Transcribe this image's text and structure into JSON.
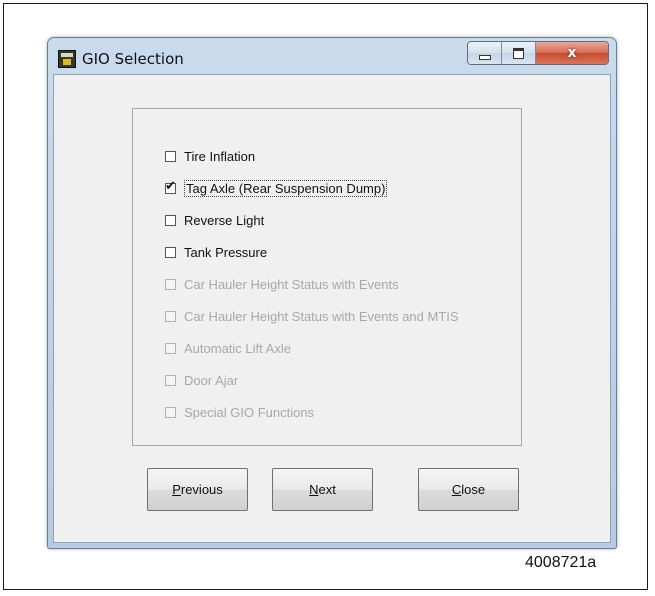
{
  "window": {
    "title": "GIO Selection",
    "close_glyph": "x",
    "icon": "app-icon"
  },
  "options": [
    {
      "label": "Tire Inflation",
      "checked": false,
      "enabled": true
    },
    {
      "label": "Tag Axle (Rear Suspension Dump)",
      "checked": true,
      "enabled": true
    },
    {
      "label": "Reverse Light",
      "checked": false,
      "enabled": true
    },
    {
      "label": "Tank Pressure",
      "checked": false,
      "enabled": true
    },
    {
      "label": "Car Hauler Height Status with Events",
      "checked": false,
      "enabled": false
    },
    {
      "label": "Car Hauler Height Status with Events and MTIS",
      "checked": false,
      "enabled": false
    },
    {
      "label": "Automatic Lift Axle",
      "checked": false,
      "enabled": false
    },
    {
      "label": "Door Ajar",
      "checked": false,
      "enabled": false
    },
    {
      "label": "Special GIO Functions",
      "checked": false,
      "enabled": false
    }
  ],
  "check_glyph": "✔",
  "buttons": {
    "previous": {
      "mnemonic": "P",
      "rest": "revious"
    },
    "next": {
      "mnemonic": "N",
      "rest": "ext"
    },
    "close": {
      "mnemonic": "C",
      "rest": "lose"
    }
  },
  "caption": "4008721a"
}
